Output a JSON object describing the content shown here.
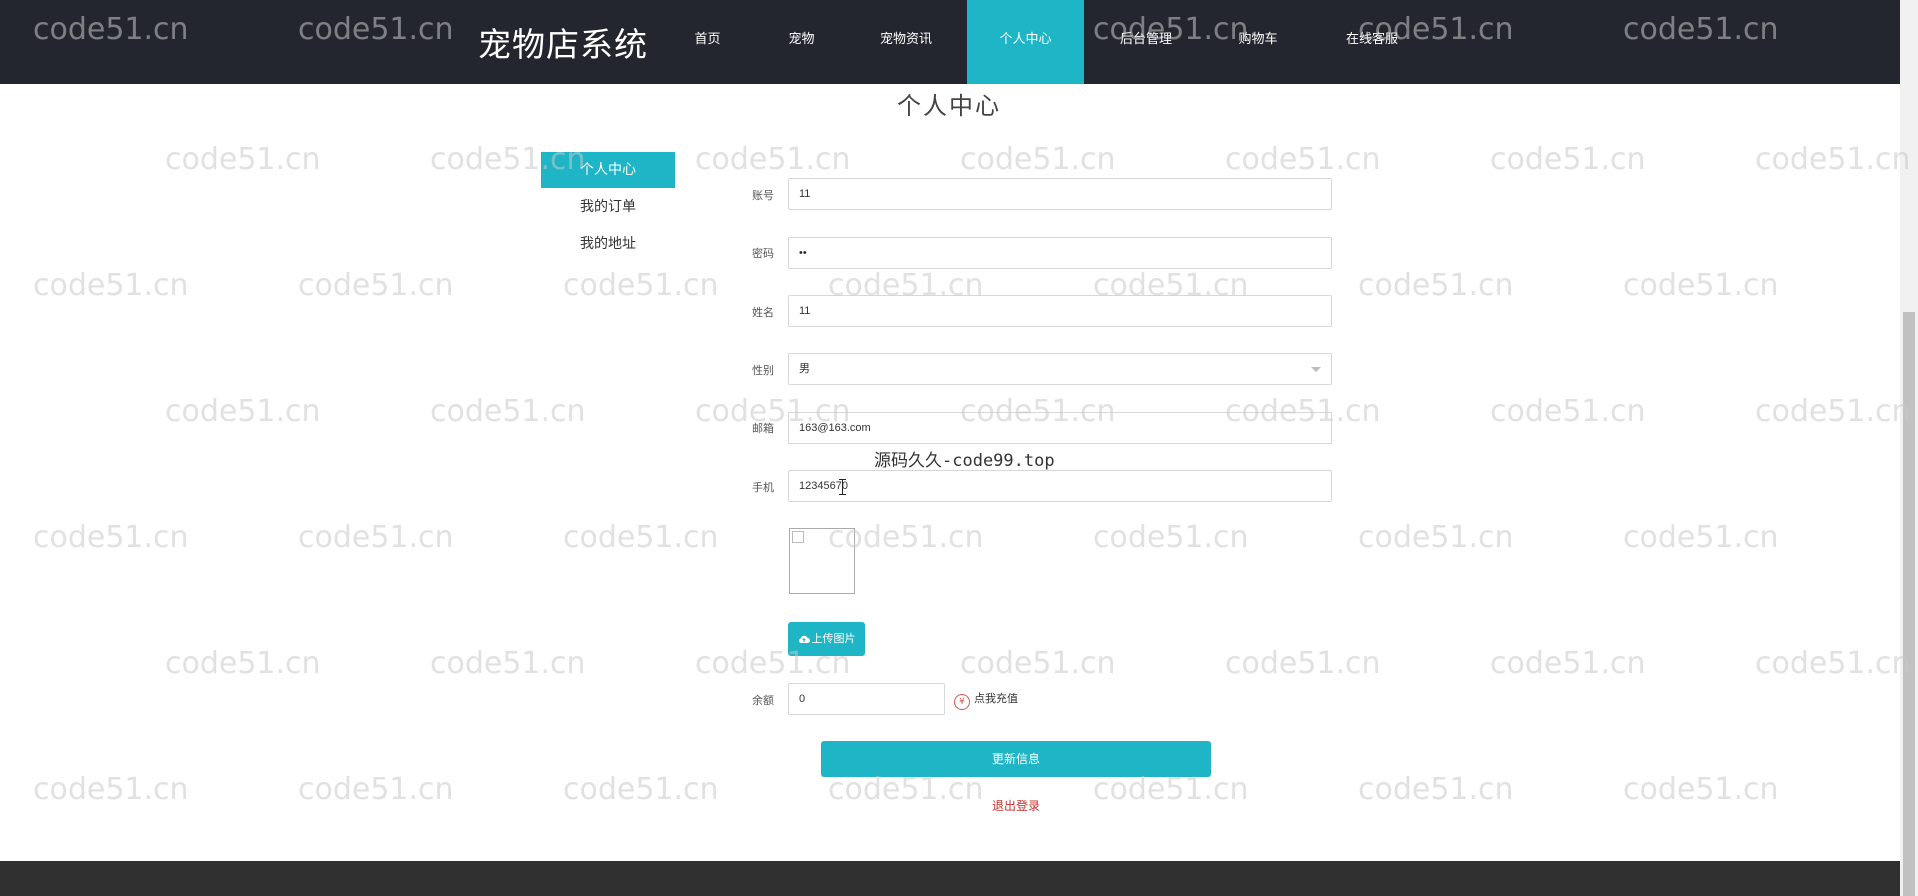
{
  "brand": "宠物店系统",
  "nav": [
    {
      "label": "首页"
    },
    {
      "label": "宠物"
    },
    {
      "label": "宠物资讯"
    },
    {
      "label": "个人中心",
      "active": true
    },
    {
      "label": "后台管理"
    },
    {
      "label": "购物车"
    },
    {
      "label": "在线客服"
    }
  ],
  "page_title": "个人中心",
  "side_menu": [
    {
      "label": "个人中心",
      "active": true
    },
    {
      "label": "我的订单"
    },
    {
      "label": "我的地址"
    }
  ],
  "form": {
    "account": {
      "label": "账号",
      "value": "11"
    },
    "password": {
      "label": "密码",
      "value": "••"
    },
    "name": {
      "label": "姓名",
      "value": "11"
    },
    "gender": {
      "label": "性别",
      "value": "男"
    },
    "email": {
      "label": "邮箱",
      "value": "163@163.com"
    },
    "phone": {
      "label": "手机",
      "value": "12345670"
    },
    "upload_label": "上传图片",
    "balance": {
      "label": "余额",
      "value": "0"
    },
    "recharge_label": "点我充值",
    "submit_label": "更新信息",
    "logout_label": "退出登录"
  },
  "watermark_text": "code51.cn",
  "overlay_text": "源码久久-code99.top",
  "colors": {
    "nav_bg": "#23262e",
    "accent": "#1eb6c6",
    "logout": "#c9302c",
    "footer": "#303030"
  }
}
